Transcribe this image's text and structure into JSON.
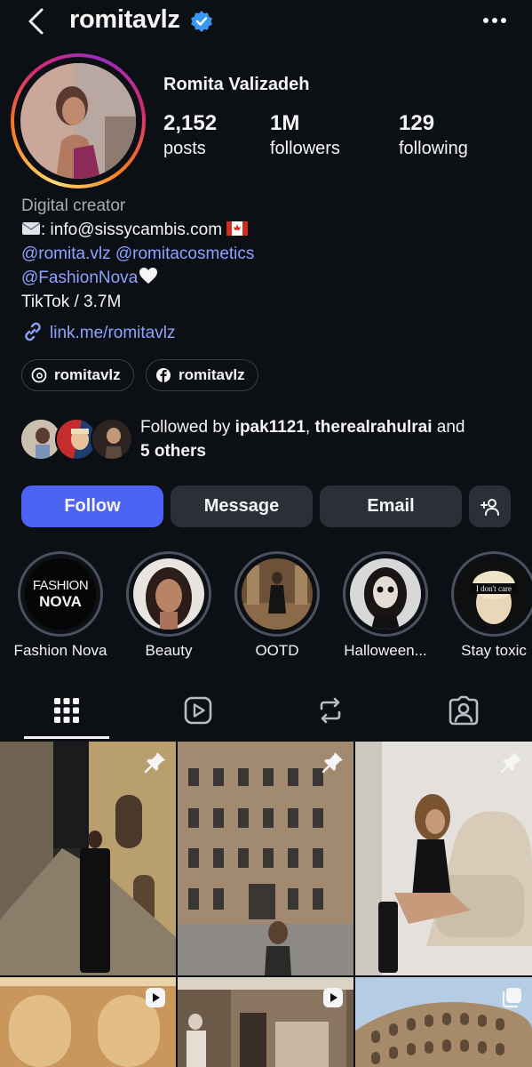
{
  "header": {
    "username": "romitavlz"
  },
  "profile": {
    "full_name": "Romita Valizadeh",
    "stats": [
      {
        "value": "2,152",
        "label": "posts"
      },
      {
        "value": "1M",
        "label": "followers"
      },
      {
        "value": "129",
        "label": "following"
      }
    ]
  },
  "bio": {
    "category": "Digital creator",
    "email_line": ": info@sissycambis.com",
    "mention1": "@romita.vlz",
    "mention2": "@romitacosmetics",
    "mention3": "@FashionNova",
    "tiktok": "TikTok / 3.7M",
    "link": "link.me/romitavlz"
  },
  "chips": [
    {
      "label": "romitavlz",
      "icon": "threads-icon"
    },
    {
      "label": "romitavlz",
      "icon": "facebook-icon"
    }
  ],
  "followed_by": {
    "prefix": "Followed by ",
    "user1": "ipak1121",
    "sep": ", ",
    "user2": "therealrahulrai",
    "and": " and",
    "others": "5 others"
  },
  "buttons": {
    "follow": "Follow",
    "message": "Message",
    "email": "Email"
  },
  "highlights": [
    {
      "label": "Fashion Nova",
      "logo_top": "FASHION",
      "logo_bottom": "NOVA"
    },
    {
      "label": "Beauty"
    },
    {
      "label": "OOTD"
    },
    {
      "label": "Halloween..."
    },
    {
      "label": "Stay toxic",
      "sign": "I don't care"
    }
  ],
  "tabs": [
    "grid-icon",
    "reels-icon",
    "reposts-icon",
    "tagged-icon"
  ],
  "colors": {
    "accent": "#4c63f5",
    "background": "#0c0f14",
    "link": "#8ea2ff",
    "verified": "#3897f0"
  }
}
